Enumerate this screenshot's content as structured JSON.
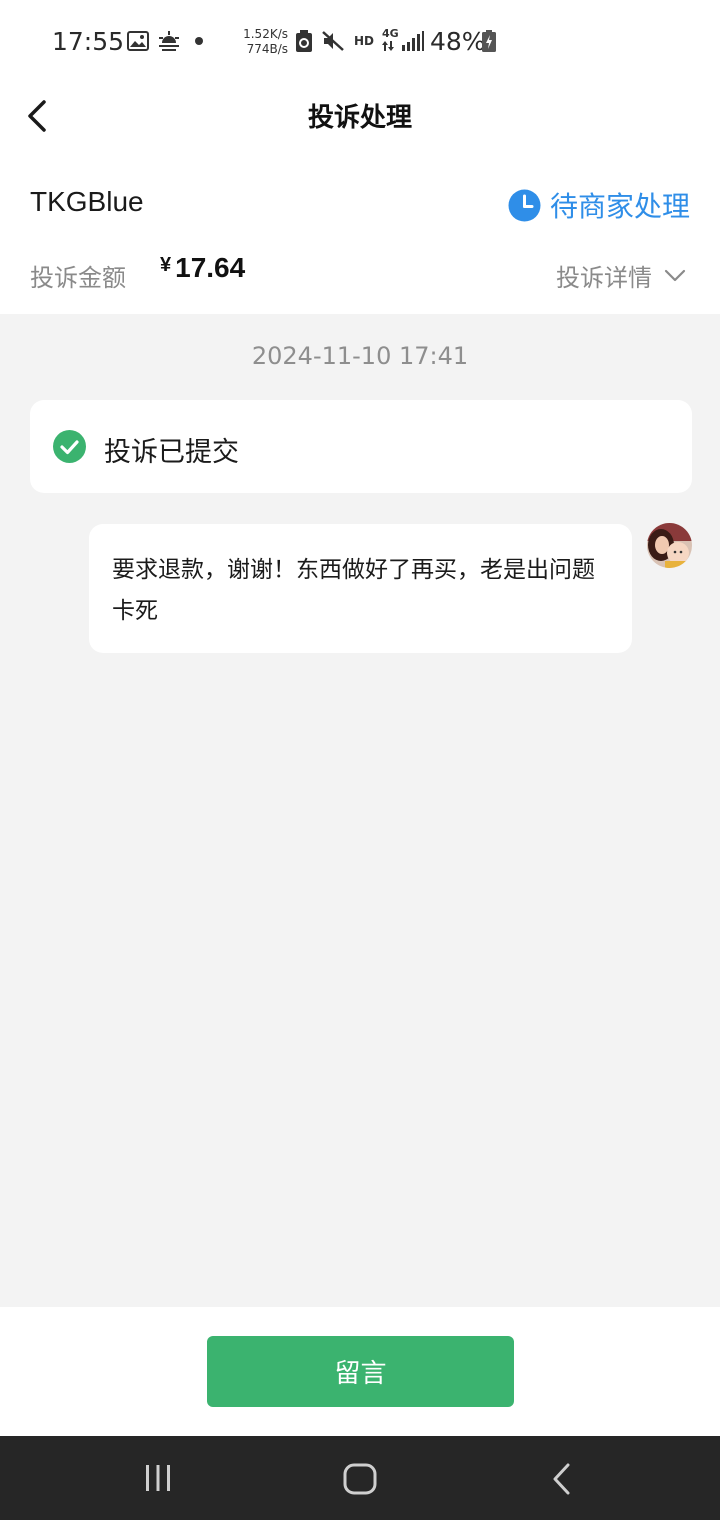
{
  "status_bar": {
    "time": "17:55",
    "speed_up": "1.52K/s",
    "speed_down": "774B/s",
    "hd": "HD",
    "network": "4G",
    "battery": "48%",
    "icons": [
      "image-icon",
      "weather-icon",
      "dot-icon",
      "recycle-icon",
      "mute-icon",
      "signal-icon",
      "battery-icon"
    ]
  },
  "nav": {
    "title": "投诉处理",
    "back_icon": "chevron-left-icon"
  },
  "header": {
    "merchant": "TKGBlue",
    "status": "待商家处理",
    "status_icon": "clock-icon",
    "status_color": "#2f8ee8",
    "amount_label": "投诉金额",
    "amount_currency": "¥",
    "amount_value": "17.64",
    "details_label": "投诉详情",
    "details_icon": "chevron-down-icon"
  },
  "timeline": {
    "timestamp": "2024-11-10 17:41",
    "submitted_text": "投诉已提交",
    "submitted_icon": "check-circle-icon",
    "accent_color": "#3bb36f"
  },
  "message": {
    "text": "要求退款，谢谢！东西做好了再买，老是出问题卡死",
    "avatar": "user-avatar"
  },
  "footer": {
    "button_label": "留言"
  },
  "system_nav": {
    "recents_icon": "recents-icon",
    "home_icon": "home-icon",
    "back_icon": "back-icon"
  }
}
